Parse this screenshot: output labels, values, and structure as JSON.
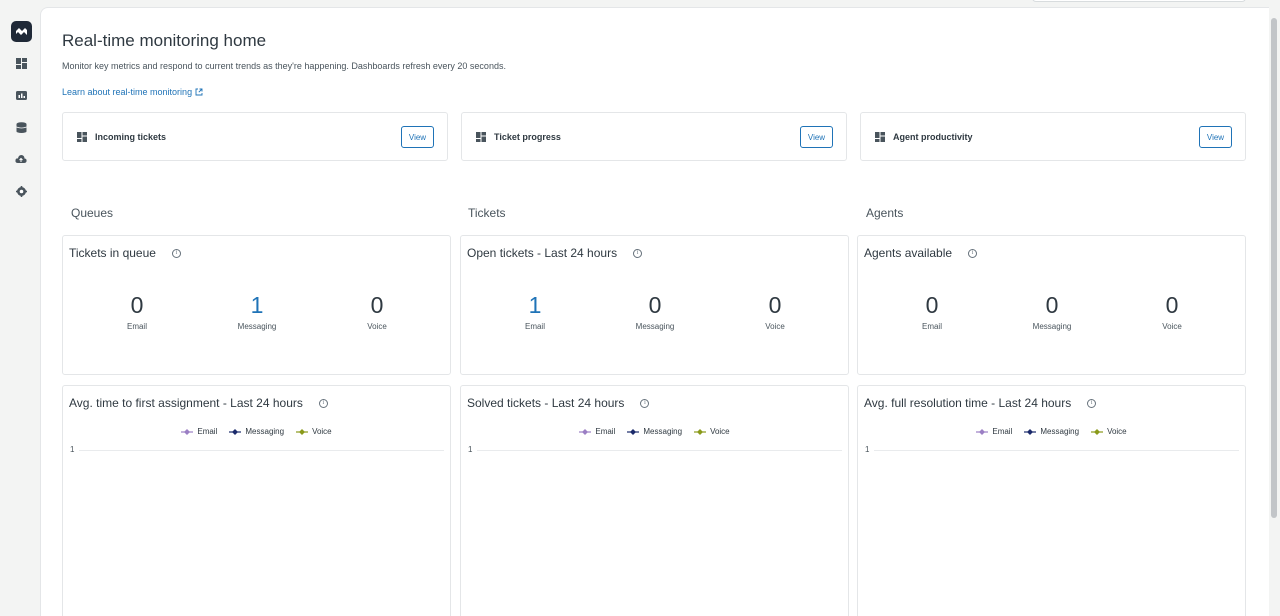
{
  "sidebar": {
    "icons": [
      "zendesk-logo-icon",
      "dashboard-icon",
      "report-icon",
      "database-icon",
      "cloud-upload-icon",
      "settings-icon"
    ]
  },
  "page": {
    "title": "Real-time monitoring home",
    "subtitle": "Monitor key metrics and respond to current trends as they're happening. Dashboards refresh every 20 seconds.",
    "learn_link": "Learn about real-time monitoring"
  },
  "dashboards": [
    {
      "label": "Incoming tickets",
      "button": "View"
    },
    {
      "label": "Ticket progress",
      "button": "View"
    },
    {
      "label": "Agent productivity",
      "button": "View"
    }
  ],
  "sections": [
    "Queues",
    "Tickets",
    "Agents"
  ],
  "kpis": [
    {
      "title": "Tickets in queue",
      "metrics": [
        {
          "value": "0",
          "label": "Email",
          "highlight": false
        },
        {
          "value": "1",
          "label": "Messaging",
          "highlight": true
        },
        {
          "value": "0",
          "label": "Voice",
          "highlight": false
        }
      ]
    },
    {
      "title": "Open tickets - Last 24 hours",
      "metrics": [
        {
          "value": "1",
          "label": "Email",
          "highlight": true
        },
        {
          "value": "0",
          "label": "Messaging",
          "highlight": false
        },
        {
          "value": "0",
          "label": "Voice",
          "highlight": false
        }
      ]
    },
    {
      "title": "Agents available",
      "metrics": [
        {
          "value": "0",
          "label": "Email",
          "highlight": false
        },
        {
          "value": "0",
          "label": "Messaging",
          "highlight": false
        },
        {
          "value": "0",
          "label": "Voice",
          "highlight": false
        }
      ]
    }
  ],
  "charts": [
    {
      "title": "Avg. time to first assignment - Last 24 hours",
      "ytick": "1"
    },
    {
      "title": "Solved tickets - Last 24 hours",
      "ytick": "1"
    },
    {
      "title": "Avg. full resolution time - Last 24 hours",
      "ytick": "1"
    }
  ],
  "legend": [
    {
      "label": "Email",
      "color": "#9b7fc4"
    },
    {
      "label": "Messaging",
      "color": "#1b2a6b"
    },
    {
      "label": "Voice",
      "color": "#8a9a1a"
    }
  ],
  "info_glyph": "i"
}
